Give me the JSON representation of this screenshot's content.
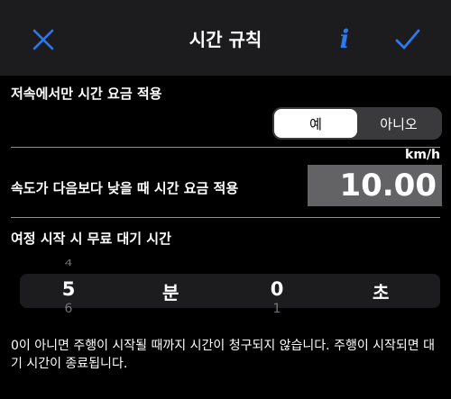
{
  "nav": {
    "title": "시간 규칙",
    "info_glyph": "i",
    "accent": "#2a7bf0"
  },
  "section1": {
    "label": "저속에서만 시간 요금 적용",
    "options": [
      "예",
      "아니오"
    ],
    "selected": "예"
  },
  "section2": {
    "unit": "km/h",
    "label": "속도가 다음보다 낮을 때 시간 요금 적용",
    "speed_value": "10.00"
  },
  "section3": {
    "label": "여정 시작 시 무료 대기 시간",
    "minutes": {
      "above": "4",
      "selected": "5",
      "below": "6",
      "unit": "분"
    },
    "seconds": {
      "above": "",
      "selected": "0",
      "below": "1",
      "unit": "초"
    }
  },
  "footnote": "0이 아니면 주행이 시작될 때까지 시간이 청구되지 않습니다. 주행이 시작되면 대기 시간이 종료됩니다."
}
